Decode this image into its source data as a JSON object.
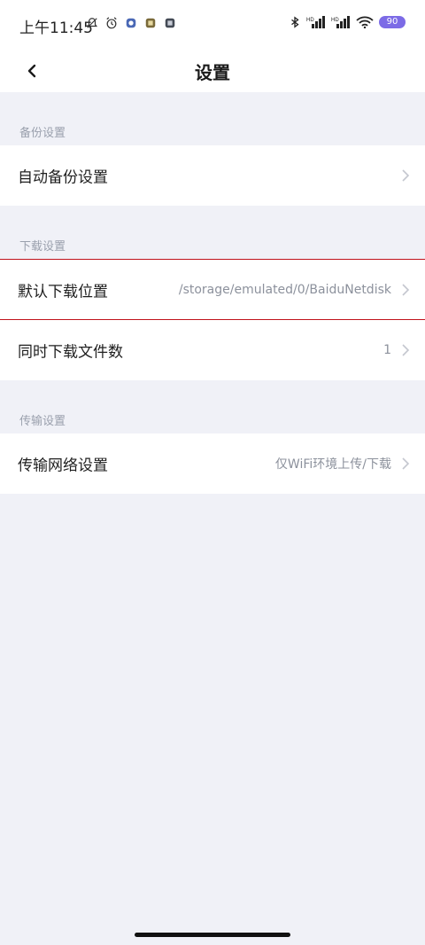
{
  "status_bar": {
    "time": "上午11:45",
    "battery": "90",
    "left_icons": [
      "mute-bell-icon",
      "alarm-icon",
      "app-notification-icon",
      "app-notification-icon",
      "app-notification-icon"
    ],
    "right_icons": [
      "bluetooth-icon",
      "signal-icon",
      "signal-icon",
      "wifi-icon",
      "battery-icon"
    ]
  },
  "nav": {
    "title": "设置",
    "back_icon": "back-chevron-icon"
  },
  "sections": {
    "backup": {
      "header": "备份设置",
      "auto_backup": {
        "label": "自动备份设置",
        "value": ""
      }
    },
    "download": {
      "header": "下载设置",
      "default_location": {
        "label": "默认下载位置",
        "value": "/storage/emulated/0/BaiduNetdisk"
      },
      "concurrent": {
        "label": "同时下载文件数",
        "value": "1"
      }
    },
    "transfer": {
      "header": "传输设置",
      "network": {
        "label": "传输网络设置",
        "value": "仅WiFi环境上传/下载"
      }
    }
  },
  "colors": {
    "background": "#f0f1f7",
    "row": "#ffffff",
    "highlight": "#c0131c",
    "secondary_text": "#8c919c"
  }
}
